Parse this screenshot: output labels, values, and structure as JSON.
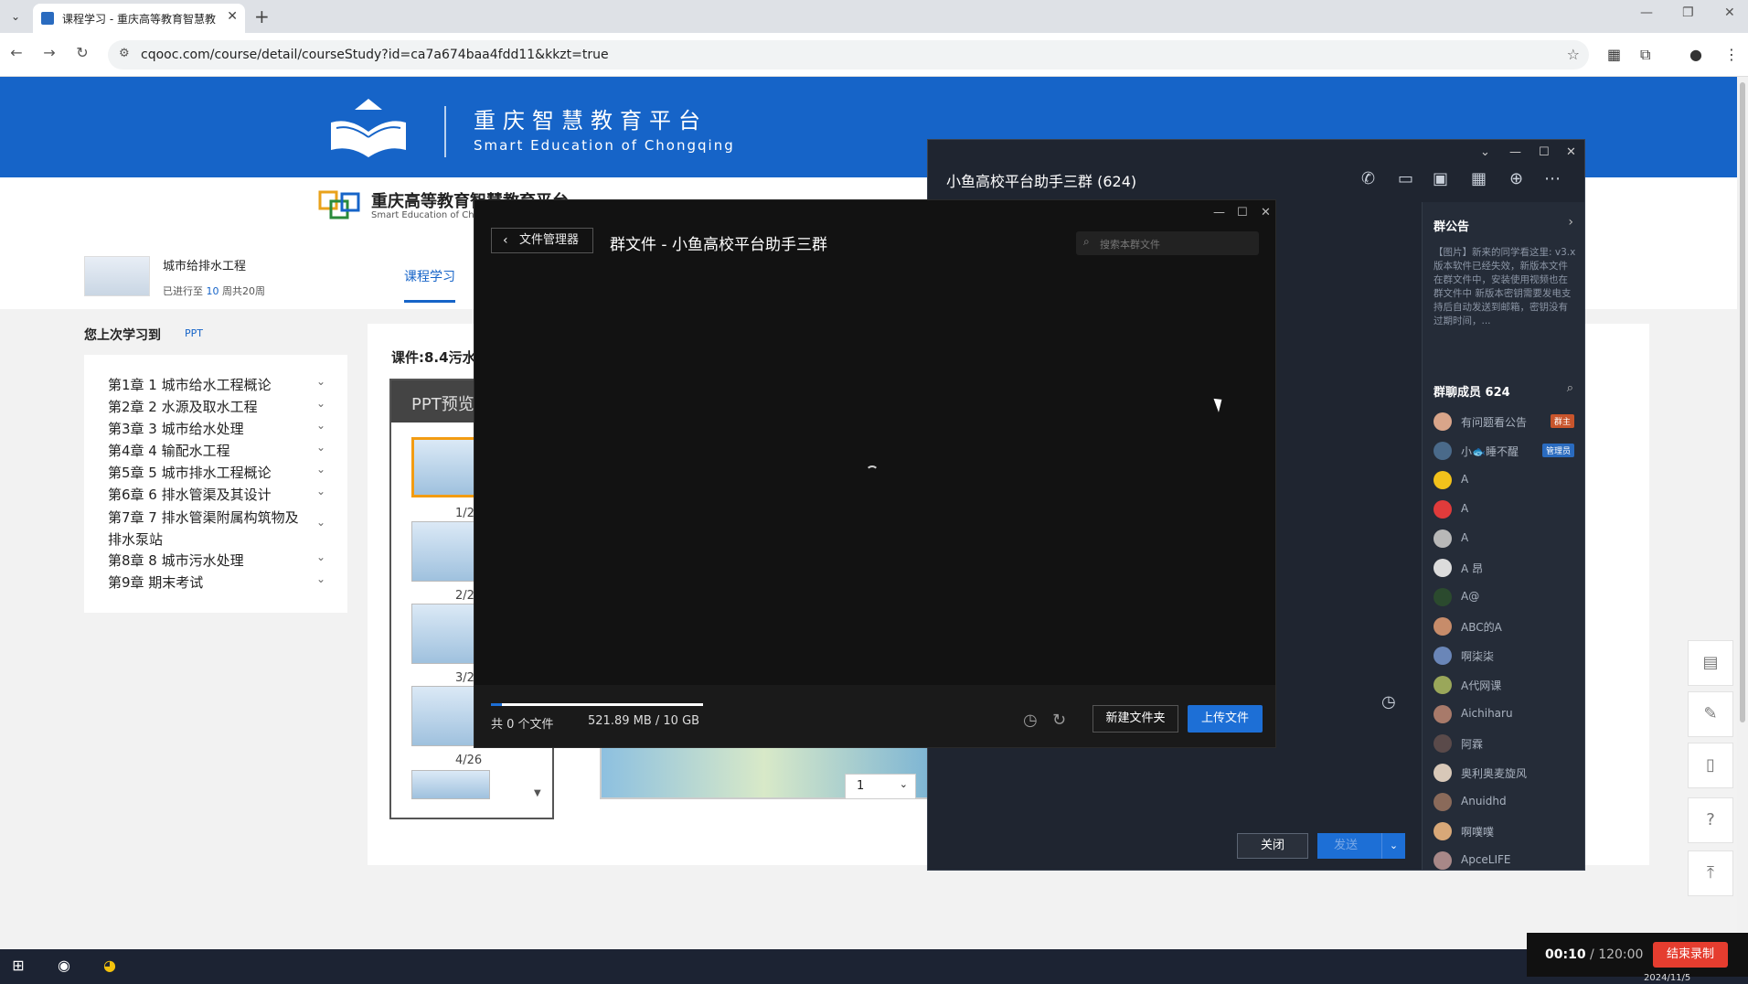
{
  "browser": {
    "tab_title": "课程学习 - 重庆高等教育智慧教",
    "new_tab": "+",
    "url": "cqooc.com/course/detail/courseStudy?id=ca7a674baa4fdd11&kkzt=true"
  },
  "banner": {
    "title_cn": "重庆智慧教育平台",
    "title_en": "Smart Education of Chongqing"
  },
  "subnav": {
    "logo_title": "重庆高等教育智慧教育平台",
    "logo_sub": "Smart Education of Chongqing"
  },
  "course": {
    "name": "城市给排水工程",
    "progress_prefix": "已进行至",
    "progress_week": "10",
    "progress_suffix": "周共20周",
    "tab_active": "课程学习"
  },
  "last_learn": {
    "label": "您上次学习到",
    "type": "PPT"
  },
  "chapters": [
    "第1章 1 城市给水工程概论",
    "第2章 2 水源及取水工程",
    "第3章 3 城市给水处理",
    "第4章 4 输配水工程",
    "第5章 5 城市排水工程概论",
    "第6章 6 排水管渠及其设计",
    "第7章 7 排水管渠附属构筑物及排水泵站",
    "第8章 8 城市污水处理",
    "第9章 期末考试"
  ],
  "courseware": {
    "title": "课件:8.4污水",
    "preview_label": "PPT预览",
    "slides": [
      "1/2",
      "2/2",
      "3/2",
      "4/26"
    ],
    "page_select": "1"
  },
  "qq_window": {
    "title": "小鱼高校平台助手三群 (624)",
    "announcement_title": "群公告",
    "announcement_text": "【图片】新来的同学看这里: v3.x版本软件已经失效，新版本文件在群文件中，安装使用视频也在群文件中 新版本密钥需要发电支持后自动发送到邮箱，密钥没有过期时间，...",
    "members_title": "群聊成员 624",
    "members": [
      {
        "name": "有问题看公告",
        "badge": "群主",
        "badge_color": "#c8552c",
        "avatar_color": "#d9a58a"
      },
      {
        "name": "小🐟睡不醒",
        "badge": "管理员",
        "badge_color": "#2a6bbf",
        "avatar_color": "#4a6a8a"
      },
      {
        "name": "A",
        "badge": "",
        "badge_color": "",
        "avatar_color": "#f3c21b"
      },
      {
        "name": "A",
        "badge": "",
        "badge_color": "",
        "avatar_color": "#e03b3b"
      },
      {
        "name": "A",
        "badge": "",
        "badge_color": "",
        "avatar_color": "#b8b8b8"
      },
      {
        "name": "A 昂",
        "badge": "",
        "badge_color": "",
        "avatar_color": "#dcdcdc"
      },
      {
        "name": "A@",
        "badge": "",
        "badge_color": "",
        "avatar_color": "#2b4a2e"
      },
      {
        "name": "ABC的A",
        "badge": "",
        "badge_color": "",
        "avatar_color": "#c78c6a"
      },
      {
        "name": "啊柒柒",
        "badge": "",
        "badge_color": "",
        "avatar_color": "#6a86b8"
      },
      {
        "name": "A代网课",
        "badge": "",
        "badge_color": "",
        "avatar_color": "#9aa75a"
      },
      {
        "name": "Aichiharu",
        "badge": "",
        "badge_color": "",
        "avatar_color": "#a87a6a"
      },
      {
        "name": "阿霖",
        "badge": "",
        "badge_color": "",
        "avatar_color": "#5a4a4a"
      },
      {
        "name": "奥利奥麦旋风",
        "badge": "",
        "badge_color": "",
        "avatar_color": "#d8c8b8"
      },
      {
        "name": "Anuidhd",
        "badge": "",
        "badge_color": "",
        "avatar_color": "#8a6a5a"
      },
      {
        "name": "啊噗噗",
        "badge": "",
        "badge_color": "",
        "avatar_color": "#d8a878"
      },
      {
        "name": "ApceLIFE",
        "badge": "",
        "badge_color": "",
        "avatar_color": "#a88888"
      }
    ],
    "close_label": "关闭",
    "send_label": "发送"
  },
  "group_files": {
    "back_label": "文件管理器",
    "title": "群文件 - 小鱼高校平台助手三群",
    "search_placeholder": "搜索本群文件",
    "file_count": "共 0 个文件",
    "storage": "521.89 MB / 10 GB",
    "storage_used_fraction": 0.051,
    "new_folder_label": "新建文件夹",
    "upload_label": "上传文件"
  },
  "recorder": {
    "elapsed": "00:10",
    "total": " / 120:00",
    "end_label": "结束录制"
  },
  "taskbar": {
    "date": "2024/11/5"
  }
}
